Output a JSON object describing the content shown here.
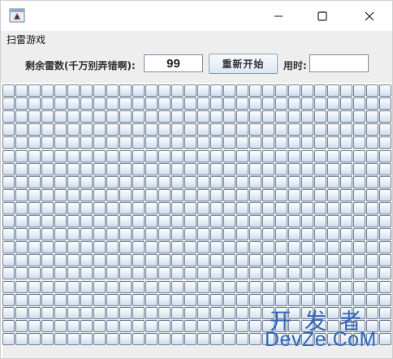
{
  "window": {
    "icon": "java-app-icon",
    "controls": [
      "minimize-icon",
      "maximize-icon",
      "close-icon"
    ]
  },
  "menu": {
    "items": [
      {
        "label": "扫雷游戏"
      }
    ]
  },
  "toolbar": {
    "mines_label": "剩余雷数(千万别弄错啊):",
    "mines_value": "99",
    "restart_label": "重新开始",
    "time_label": "用时:",
    "time_value": ""
  },
  "board": {
    "cols": 30,
    "rows": 20,
    "tile_style": "unrevealed"
  },
  "watermark": {
    "line1": "开发者",
    "line2": "DevZe.CoM"
  },
  "colors": {
    "accent": "#3367b8",
    "tile_border": "#6d7f95",
    "chrome": "#eeeeee"
  }
}
